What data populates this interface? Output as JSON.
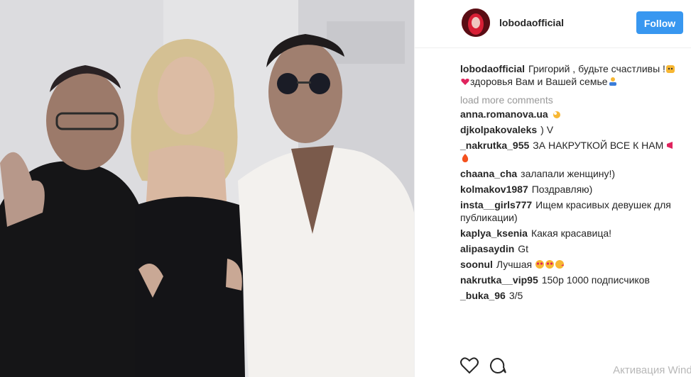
{
  "post": {
    "username": "lobodaofficial",
    "follow_label": "Follow"
  },
  "caption": {
    "username": "lobodaofficial",
    "text": "Григорий , будьте счастливы !",
    "text2": "здоровья Вам и Вашей семье"
  },
  "load_more": "load more comments",
  "comments": [
    {
      "user": "anna.romanova.ua",
      "text": ""
    },
    {
      "user": "djkolpakovaleks",
      "text": ") V"
    },
    {
      "user": "_nakrutka_955",
      "text": "ЗА НАКРУТКОЙ ВСЕ К НАМ"
    },
    {
      "user": "chaana_cha",
      "text": "залапали женщину!)"
    },
    {
      "user": "kolmakov1987",
      "text": "Поздравляю)"
    },
    {
      "user": "insta__girls777",
      "text": "Ищем красивых девушек для публикации)"
    },
    {
      "user": "kaplya_ksenia",
      "text": "Какая красавица!"
    },
    {
      "user": "alipasaydin",
      "text": "Gt"
    },
    {
      "user": "soonul",
      "text": "Лучшая"
    },
    {
      "user": "nakrutka__vip95",
      "text": "150р 1000 подписчиков"
    },
    {
      "user": "_buka_96",
      "text": "3/5"
    }
  ],
  "icons": [
    "heart-icon",
    "comment-icon"
  ],
  "system": {
    "watermark": "Активация Windo"
  },
  "colors": {
    "accent": "#3897f0",
    "muted": "#999999",
    "text": "#262626"
  }
}
